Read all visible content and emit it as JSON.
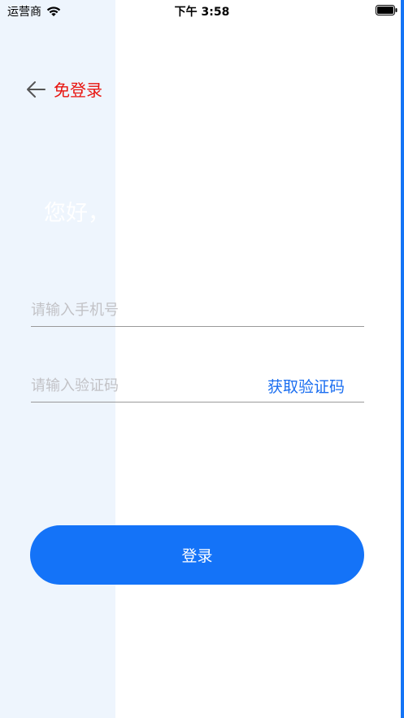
{
  "status_bar": {
    "carrier": "运营商",
    "time": "下午 3:58"
  },
  "header": {
    "title": "免登录"
  },
  "greeting": "您好，",
  "form": {
    "phone_placeholder": "请输入手机号",
    "code_placeholder": "请输入验证码",
    "get_code_label": "获取验证码",
    "login_label": "登录"
  },
  "colors": {
    "accent": "#1473f8",
    "title_red": "#e8140f",
    "left_panel": "#eef5fd"
  },
  "icons": [
    "wifi-icon",
    "battery-icon",
    "back-arrow-icon"
  ]
}
